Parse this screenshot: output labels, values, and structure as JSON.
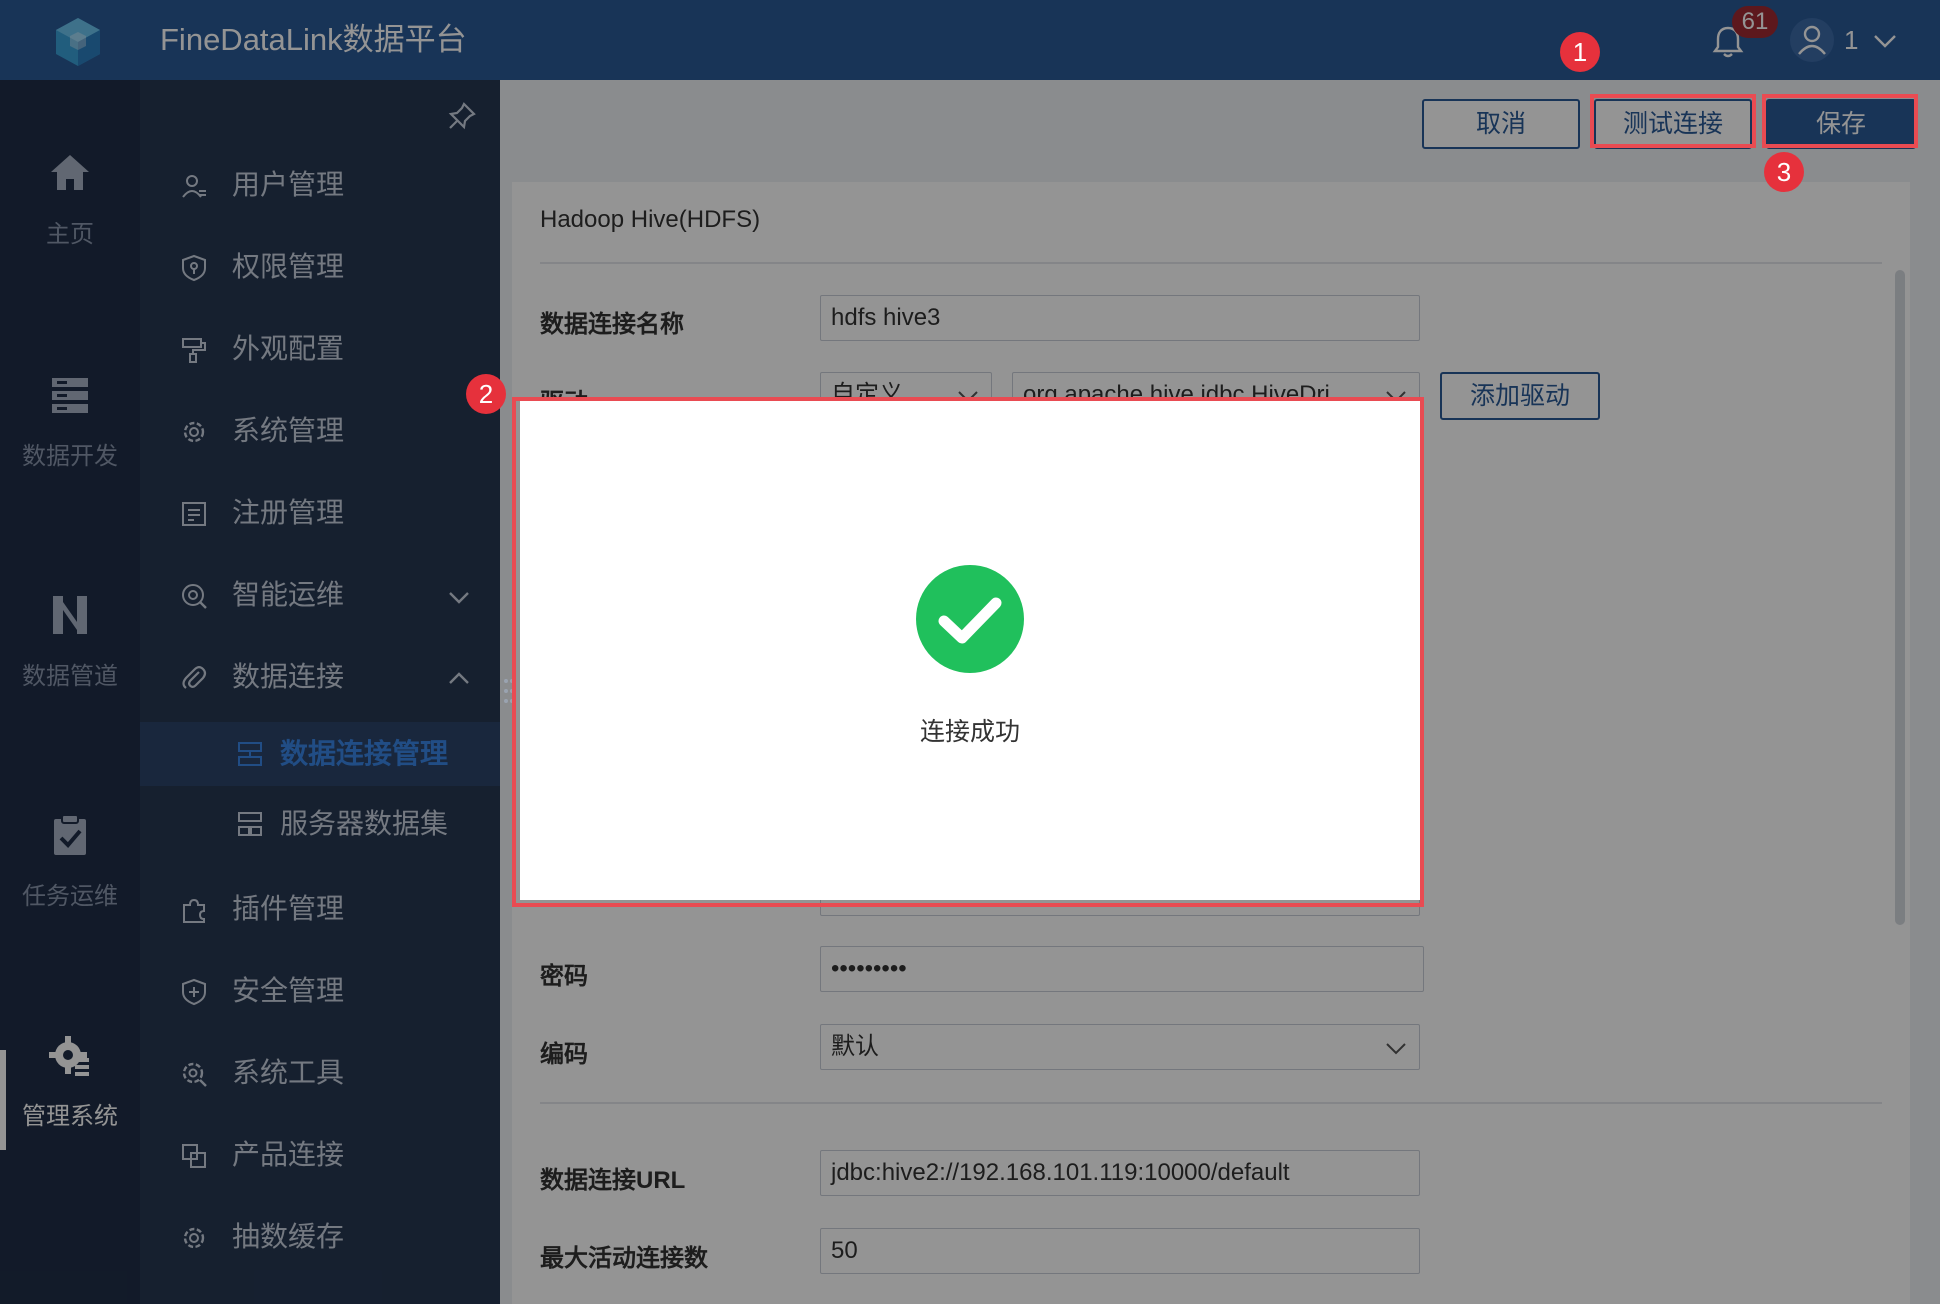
{
  "app": {
    "title": "FineDataLink数据平台"
  },
  "header": {
    "notification_count": "61",
    "user_name": "1"
  },
  "leftnav": [
    {
      "label": "主页",
      "icon": "home-icon"
    },
    {
      "label": "数据开发",
      "icon": "data-dev-icon"
    },
    {
      "label": "数据管道",
      "icon": "pipeline-icon"
    },
    {
      "label": "任务运维",
      "icon": "task-ops-icon"
    },
    {
      "label": "管理系统",
      "icon": "gear-admin-icon",
      "active": true
    }
  ],
  "submenu": {
    "items": [
      {
        "label": "用户管理",
        "icon": "user-icon"
      },
      {
        "label": "权限管理",
        "icon": "shield-lock-icon"
      },
      {
        "label": "外观配置",
        "icon": "paint-roller-icon"
      },
      {
        "label": "系统管理",
        "icon": "gear-icon"
      },
      {
        "label": "注册管理",
        "icon": "register-icon"
      },
      {
        "label": "智能运维",
        "icon": "smart-ops-icon",
        "expand": "down"
      },
      {
        "label": "数据连接",
        "icon": "paperclip-icon",
        "expand": "up"
      },
      {
        "label": "插件管理",
        "icon": "puzzle-icon"
      },
      {
        "label": "安全管理",
        "icon": "shield-plus-icon"
      },
      {
        "label": "系统工具",
        "icon": "tool-gear-icon"
      },
      {
        "label": "产品连接",
        "icon": "product-link-icon"
      },
      {
        "label": "抽数缓存",
        "icon": "cache-gear-icon"
      }
    ],
    "subitems": [
      {
        "label": "数据连接管理",
        "selected": true
      },
      {
        "label": "服务器数据集"
      }
    ]
  },
  "toolbar": {
    "cancel": "取消",
    "test": "测试连接",
    "save": "保存"
  },
  "form": {
    "title": "Hadoop Hive(HDFS)",
    "name_label": "数据连接名称",
    "name_value": "hdfs hive3",
    "driver_label": "驱动",
    "driver_type": "自定义",
    "driver_class": "org.apache.hive.jdbc.HiveDri...",
    "add_driver": "添加驱动",
    "password_label": "密码",
    "password_value": "•••••••••",
    "encoding_label": "编码",
    "encoding_value": "默认",
    "url_label": "数据连接URL",
    "url_value": "jdbc:hive2://192.168.101.119:10000/default",
    "max_conn_label": "最大活动连接数",
    "max_conn_value": "50"
  },
  "modal": {
    "message": "连接成功"
  },
  "annotations": [
    "1",
    "2",
    "3"
  ],
  "colors": {
    "topbar": "#2a5a97",
    "nav": "#1f2e47",
    "submenu": "#263752",
    "accent": "#3a86e6",
    "success": "#20c05c",
    "annotation": "#e94b52"
  }
}
